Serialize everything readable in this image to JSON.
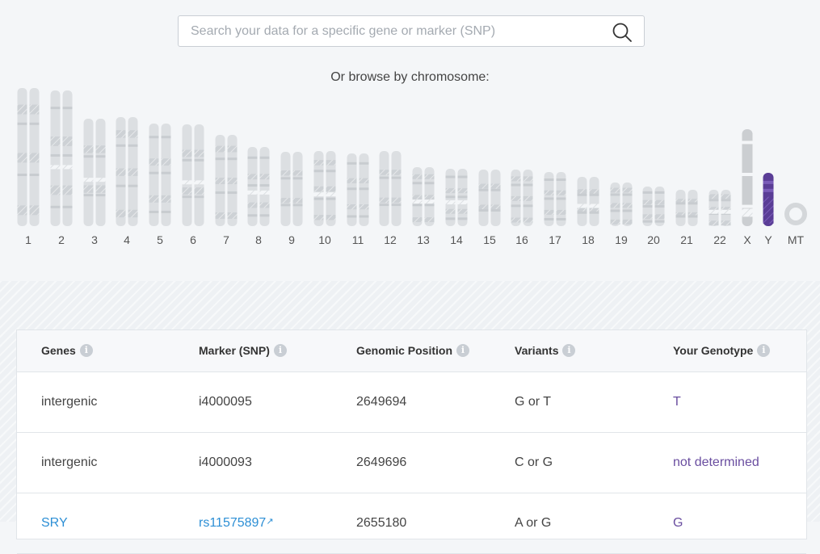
{
  "search": {
    "placeholder": "Search your data for a specific gene or marker (SNP)"
  },
  "browse_label": "Or browse by chromosome:",
  "chromosomes": [
    "1",
    "2",
    "3",
    "4",
    "5",
    "6",
    "7",
    "8",
    "9",
    "10",
    "11",
    "12",
    "13",
    "14",
    "15",
    "16",
    "17",
    "18",
    "19",
    "20",
    "21",
    "22",
    "X",
    "Y",
    "MT"
  ],
  "selected_chromosome": "Y",
  "colors": {
    "chromosome": "#dcdfe2",
    "chromosome_band": "#c8ccd0",
    "selected": "#5a3d96",
    "selected_band": "#7a5cb8",
    "x_chromosome": "#cbced1",
    "link": "#2d8fd5",
    "genotype": "#6a4ea0"
  },
  "table": {
    "headers": [
      "Genes",
      "Marker (SNP)",
      "Genomic Position",
      "Variants",
      "Your Genotype"
    ],
    "rows": [
      {
        "gene": "intergenic",
        "marker": "i4000095",
        "position": "2649694",
        "variants": "G or T",
        "genotype": "T"
      },
      {
        "gene": "intergenic",
        "marker": "i4000093",
        "position": "2649696",
        "variants": "C or G",
        "genotype": "not determined"
      },
      {
        "gene": "SRY",
        "marker": "rs11575897",
        "position": "2655180",
        "variants": "A or G",
        "genotype": "G"
      }
    ]
  }
}
